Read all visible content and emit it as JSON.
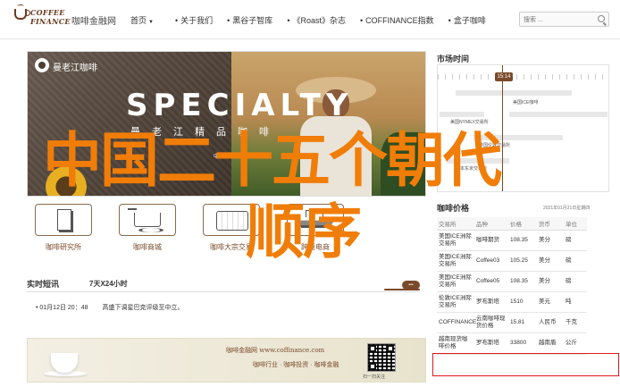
{
  "header": {
    "logo_line1": "COFFEE",
    "logo_line2": "FINANCE",
    "site_name": "咖啡金融网",
    "nav": [
      {
        "label": "首页",
        "has_caret": true
      },
      {
        "label": "关于我们"
      },
      {
        "label": "黑谷子智库"
      },
      {
        "label": "《Roast》杂志"
      },
      {
        "label": "COFFINANCE指数"
      },
      {
        "label": "盒子咖啡"
      }
    ],
    "search_placeholder": "搜索 ..."
  },
  "hero": {
    "brand": "曼老江咖啡",
    "headline": "SPECIALTY",
    "subline": "曼老江精品咖啡",
    "place": "中国 · 云南"
  },
  "overlay": {
    "line1": "中国二十五个朝代",
    "line2": "顺序"
  },
  "categories": [
    {
      "label": "咖啡研究所",
      "icon": "book-icon"
    },
    {
      "label": "咖啡商城",
      "icon": "cart-icon"
    },
    {
      "label": "咖啡大宗交易",
      "icon": "trade-icon"
    },
    {
      "label": "跨境电商",
      "icon": "ship-icon"
    }
  ],
  "news": {
    "title": "实时短讯",
    "subtitle": "7天X24小时",
    "items": [
      {
        "time": "• 01月12日 20：48",
        "text": "高盛下调星巴克评级至中立。"
      }
    ]
  },
  "ad": {
    "line1": "咖啡金融网 www.coffinance.com",
    "line2": "咖啡行业 · 咖啡投资 · 咖啡金融",
    "qr_caption": "扫一扫关注"
  },
  "market_time": {
    "title": "市场时间",
    "now": "15:14",
    "rows": [
      {
        "label": "美国ICE咖啡"
      },
      {
        "label": "美国NYMEX交易所"
      },
      {
        "label": "英国伦敦交易所"
      },
      {
        "label": "日本东京交易所"
      }
    ]
  },
  "prices": {
    "title": "咖啡价格",
    "date": "2021年01月21日星期四",
    "columns": [
      "交易所",
      "品种",
      "价格",
      "货币",
      "单位"
    ],
    "rows": [
      [
        "美国ICE洲际交易所",
        "咖啡期货",
        "108.35",
        "美分",
        "磅"
      ],
      [
        "美国ICE洲际交易所",
        "Coffee03",
        "105.25",
        "美分",
        "磅"
      ],
      [
        "美国ICE洲际交易所",
        "Coffee05",
        "108.35",
        "美分",
        "磅"
      ],
      [
        "伦敦ICE洲际交易所",
        "罗布斯塔",
        "1510",
        "美元",
        "吨"
      ],
      [
        "COFFINANCE",
        "云南咖啡现货价格",
        "15.81",
        "人民币",
        "千克"
      ],
      [
        "越南现货咖啡价格",
        "罗布斯塔",
        "33800",
        "越南盾",
        "公斤"
      ]
    ]
  },
  "colors": {
    "brand_brown": "#7a4a2a",
    "overlay_orange": "#f07d08",
    "highlight_red": "#e0191e"
  }
}
